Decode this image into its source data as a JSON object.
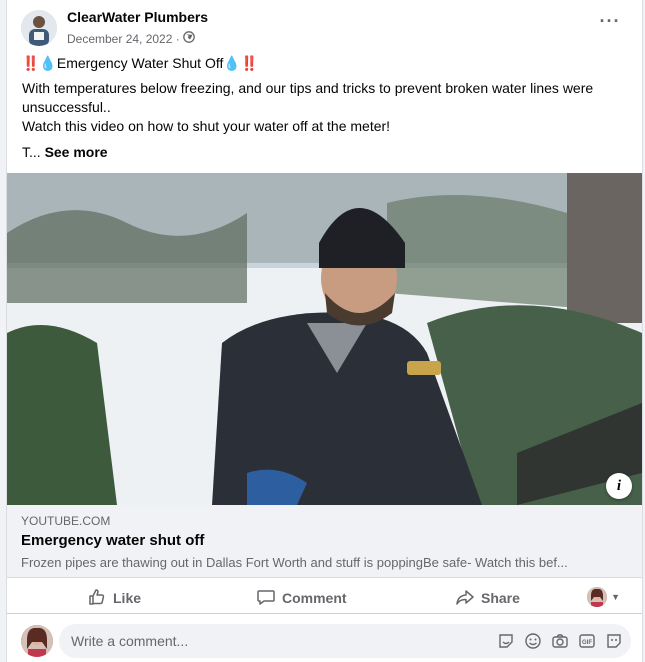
{
  "post": {
    "page_name": "ClearWater Plumbers",
    "date": "December 24, 2022 · ",
    "title_line": "‼️💧Emergency Water Shut Off💧‼️",
    "body_line1": "With temperatures below freezing, and our tips and tricks to prevent broken water lines were unsuccessful..",
    "body_line2": "Watch this video on how to shut your water off at the meter!",
    "truncated": "T... ",
    "see_more": "See more"
  },
  "link": {
    "domain": "YOUTUBE.COM",
    "title": "Emergency water shut off",
    "description": "Frozen pipes are thawing out in Dallas Fort Worth and stuff is poppingBe safe- Watch this bef..."
  },
  "actions": {
    "like": "Like",
    "comment": "Comment",
    "share": "Share"
  },
  "comment": {
    "placeholder": "Write a comment..."
  },
  "icons": {
    "more": "more-options-icon",
    "globe": "globe-icon",
    "info": "info-icon",
    "like": "thumbs-up-icon",
    "comment": "speech-bubble-icon",
    "share": "share-arrow-icon",
    "sticker": "sticker-icon",
    "emoji": "emoji-icon",
    "camera": "camera-icon",
    "gif": "gif-icon",
    "avatar_sticker": "avatar-sticker-icon"
  },
  "colors": {
    "secondary_text": "#65676b",
    "link_bg": "#f0f2f5"
  }
}
